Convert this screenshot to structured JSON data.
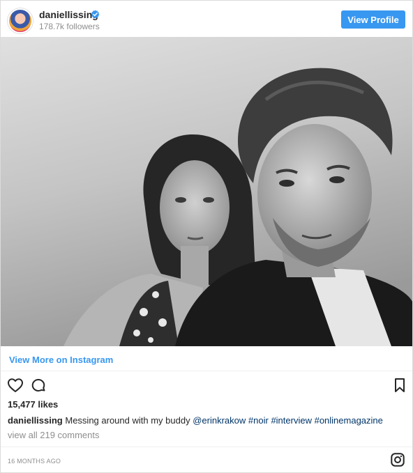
{
  "header": {
    "username": "daniellissing",
    "followers": "178.7k followers",
    "view_profile_label": "View Profile",
    "avatar_icon": "avatar",
    "verified_icon": "verified-badge-icon",
    "accent_color": "#3897f0"
  },
  "photo": {
    "icon": "photo",
    "style": "black-and-white portrait"
  },
  "view_more_label": "View More on Instagram",
  "actions": {
    "like_icon": "heart-icon",
    "comment_icon": "comment-icon",
    "save_icon": "bookmark-icon"
  },
  "likes": "15,477 likes",
  "caption": {
    "username": "daniellissing",
    "text_before": "Messing around with my buddy",
    "mention": "@erinkrakow",
    "hashtags": [
      "#noir",
      "#interview",
      "#onlinemagazine"
    ]
  },
  "comments_label": "view all 219 comments",
  "timestamp": "16 MONTHS AGO",
  "footer": {
    "logo_icon": "instagram-icon"
  }
}
